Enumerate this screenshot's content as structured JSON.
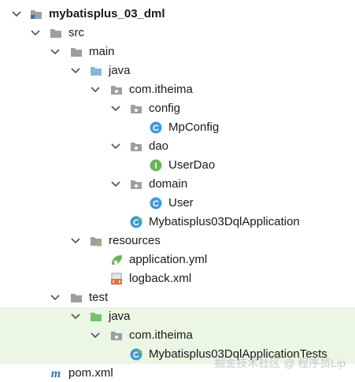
{
  "tree": {
    "project": "mybatisplus_03_dml",
    "src": "src",
    "main": "main",
    "java_main": "java",
    "pkg_main": "com.itheima",
    "config": "config",
    "mpconfig": "MpConfig",
    "dao": "dao",
    "userdao": "UserDao",
    "domain": "domain",
    "user": "User",
    "app": "Mybatisplus03DqlApplication",
    "resources": "resources",
    "app_yml": "application.yml",
    "logback": "logback.xml",
    "test": "test",
    "java_test": "java",
    "pkg_test": "com.itheima",
    "app_tests": "Mybatisplus03DqlApplicationTests",
    "pom": "pom.xml"
  },
  "icons": {
    "class_badge": "C",
    "interface_badge": "I",
    "pom_glyph": "m"
  },
  "watermark": "掘金技术社区 @ 程序员Lip",
  "colors": {
    "folder": "#9aa0a6",
    "source_folder": "#87b6d6",
    "test_folder": "#78c26e",
    "class_icon": "#3c9ad6",
    "interface_icon": "#6db35a",
    "highlight": "#ebf6e4",
    "chevron": "#5a5a5a"
  }
}
